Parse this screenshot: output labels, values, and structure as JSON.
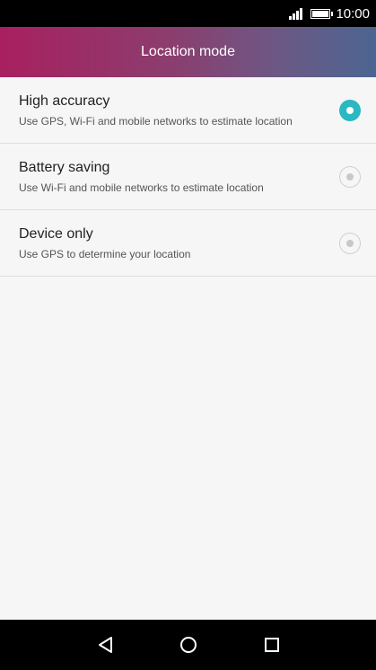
{
  "status_bar": {
    "time": "10:00",
    "icons": [
      "signal-icon",
      "battery-icon"
    ]
  },
  "header": {
    "title": "Location mode"
  },
  "options": [
    {
      "title": "High accuracy",
      "description": "Use GPS, Wi-Fi and mobile networks to estimate location",
      "selected": true
    },
    {
      "title": "Battery saving",
      "description": "Use Wi-Fi and mobile networks to estimate location",
      "selected": false
    },
    {
      "title": "Device only",
      "description": "Use GPS to determine your location",
      "selected": false
    }
  ],
  "nav_bar": {
    "icons": [
      "back-icon",
      "home-icon",
      "recents-icon"
    ]
  },
  "colors": {
    "accent": "#2ab8c2",
    "header_gradient_start": "#a8205f",
    "header_gradient_end": "#4c6591"
  }
}
